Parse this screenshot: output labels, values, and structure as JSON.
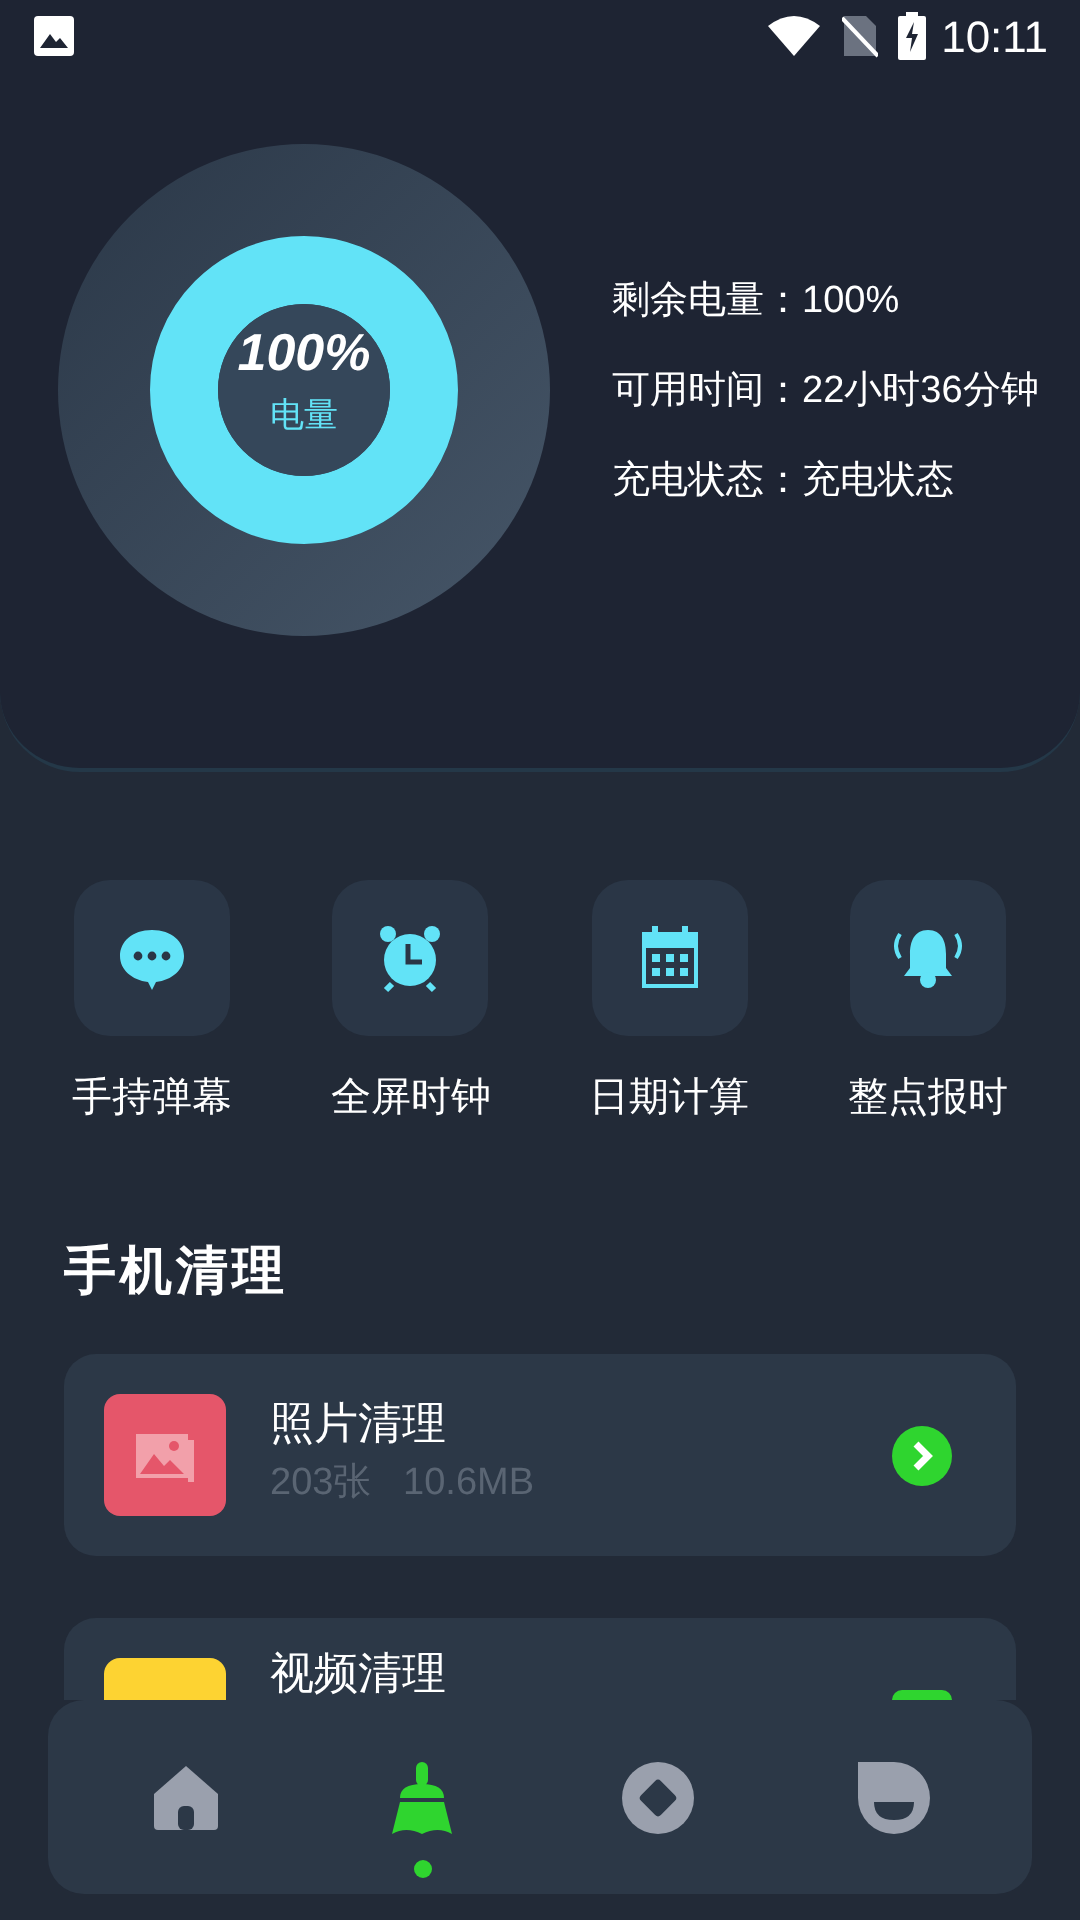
{
  "status_bar": {
    "time": "10:11"
  },
  "battery": {
    "level": 1,
    "percent": "100%",
    "caption": "电量",
    "info": [
      {
        "label": "剩余电量：",
        "value": "100%"
      },
      {
        "label": "可用时间：",
        "value": "22小时36分钟"
      },
      {
        "label": "充电状态：",
        "value": "充电状态"
      }
    ]
  },
  "tools": [
    {
      "kind": "chat",
      "label": "手持弹幕"
    },
    {
      "kind": "alarm",
      "label": "全屏时钟"
    },
    {
      "kind": "calendar",
      "label": "日期计算"
    },
    {
      "kind": "bell",
      "label": "整点报时"
    }
  ],
  "section_title": "手机清理",
  "clean_items": [
    {
      "kind": "photo",
      "title": "照片清理",
      "count": "203张",
      "size": "10.6MB"
    },
    {
      "kind": "video",
      "title": "视频清理"
    }
  ],
  "nav": [
    {
      "kind": "home",
      "selected": false
    },
    {
      "kind": "clean",
      "selected": true
    },
    {
      "kind": "diamond",
      "selected": false
    },
    {
      "kind": "face",
      "selected": false
    }
  ]
}
